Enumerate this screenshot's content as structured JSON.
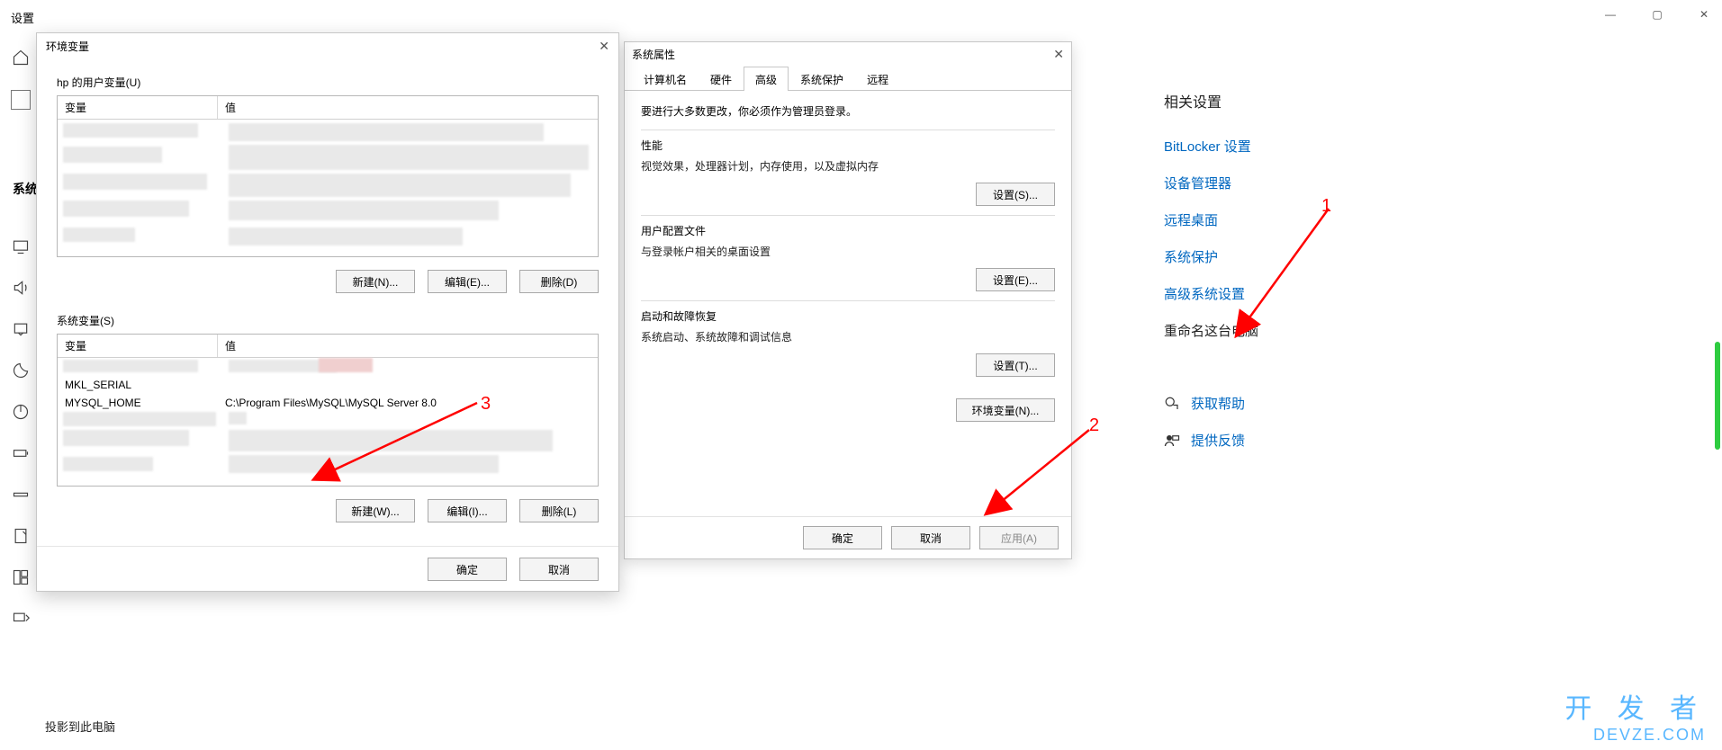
{
  "settings": {
    "title": "设置",
    "left_label": "系统",
    "projection_text": "投影到此电脑"
  },
  "related": {
    "heading": "相关设置",
    "links": [
      "BitLocker 设置",
      "设备管理器",
      "远程桌面",
      "系统保护",
      "高级系统设置"
    ],
    "rename": "重命名这台电脑",
    "help": "获取帮助",
    "feedback": "提供反馈"
  },
  "sysprops": {
    "title": "系统属性",
    "tabs": [
      "计算机名",
      "硬件",
      "高级",
      "系统保护",
      "远程"
    ],
    "active_tab": 2,
    "note": "要进行大多数更改，你必须作为管理员登录。",
    "perf": {
      "title": "性能",
      "desc": "视觉效果，处理器计划，内存使用，以及虚拟内存",
      "btn": "设置(S)..."
    },
    "profile": {
      "title": "用户配置文件",
      "desc": "与登录帐户相关的桌面设置",
      "btn": "设置(E)..."
    },
    "startup": {
      "title": "启动和故障恢复",
      "desc": "系统启动、系统故障和调试信息",
      "btn": "设置(T)..."
    },
    "envbtn": "环境变量(N)...",
    "ok": "确定",
    "cancel": "取消",
    "apply": "应用(A)"
  },
  "env": {
    "title": "环境变量",
    "user_section": "hp 的用户变量(U)",
    "sys_section": "系统变量(S)",
    "col_var": "变量",
    "col_val": "值",
    "user_rows": [],
    "sys_rows": [
      {
        "var": "MKL_SERIAL",
        "val": ""
      },
      {
        "var": "MYSQL_HOME",
        "val": "C:\\Program Files\\MySQL\\MySQL Server 8.0"
      }
    ],
    "sys_partial": "en-3.5",
    "new_u": "新建(N)...",
    "edit_u": "编辑(E)...",
    "del_u": "删除(D)",
    "new_s": "新建(W)...",
    "edit_s": "编辑(I)...",
    "del_s": "删除(L)",
    "ok": "确定",
    "cancel": "取消"
  },
  "annotations": {
    "n1": "1",
    "n2": "2",
    "n3": "3"
  },
  "watermark": {
    "zh": "开 发 者",
    "en": "DEVZE.COM"
  }
}
